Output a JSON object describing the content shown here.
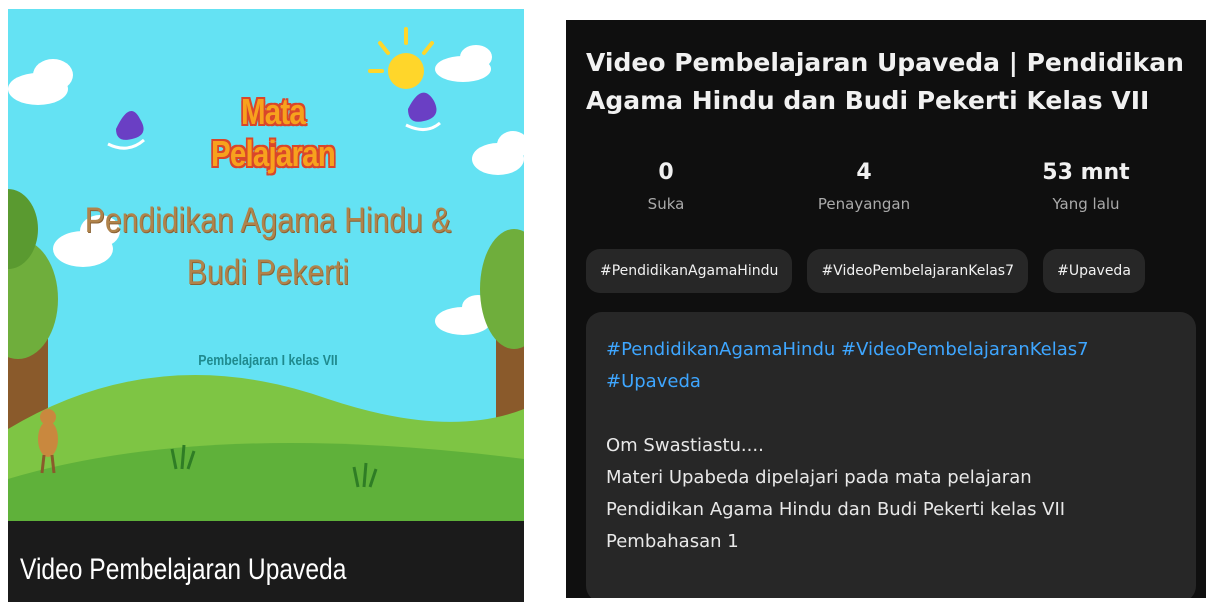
{
  "thumbnail": {
    "heading": "Mata Pelajaran",
    "subject_line1": "Pendidikan Agama Hindu &",
    "subject_line2": "Budi Pekerti",
    "meta": "Pembelajaran I kelas VII",
    "caption": "Video Pembelajaran Upaveda"
  },
  "details": {
    "title_line1": "Video Pembelajaran Upaveda | Pendidikan",
    "title_line2": "Agama Hindu dan Budi Pekerti Kelas VII",
    "stats": {
      "likes_value": "0",
      "likes_label": "Suka",
      "views_value": "4",
      "views_label": "Penayangan",
      "time_value": "53 mnt",
      "time_label": "Yang lalu"
    },
    "tags": [
      "#PendidikanAgamaHindu",
      "#VideoPembelajaranKelas7",
      "#Upaveda"
    ],
    "description": {
      "hashtags_line1": "#PendidikanAgamaHindu #VideoPembelajaranKelas7",
      "hashtags_line2": "#Upaveda",
      "body": [
        "Om Swastiastu....",
        "Materi Upabeda dipelajari pada mata pelajaran",
        "Pendidikan Agama Hindu dan Budi Pekerti kelas VII",
        "Pembahasan 1"
      ]
    }
  },
  "colors": {
    "sky": "#64e2f3",
    "panel_bg": "#0f0f0f",
    "chip_bg": "#272727",
    "link": "#3ea6ff"
  }
}
